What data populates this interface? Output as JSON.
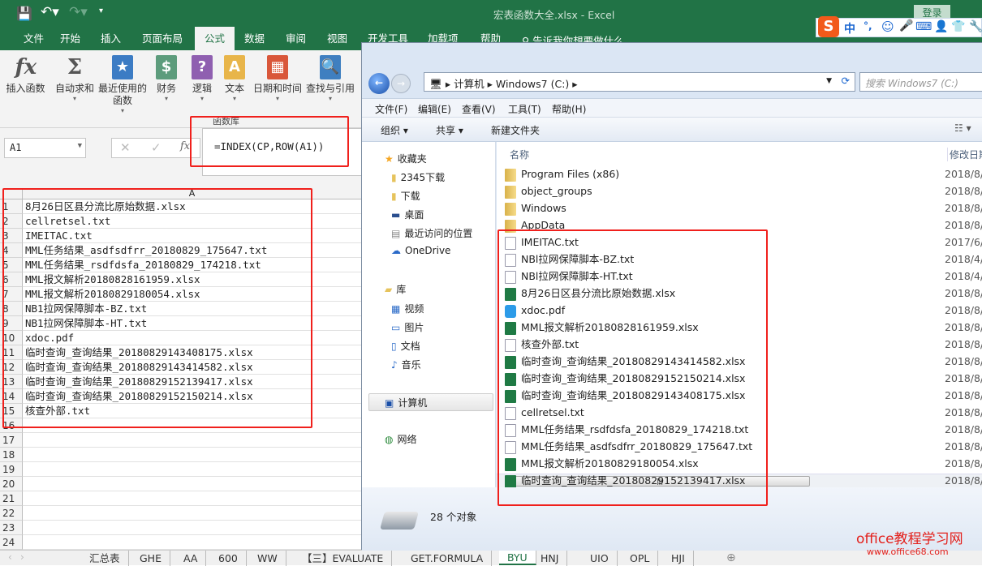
{
  "window_title": "宏表函数大全.xlsx  -  Excel",
  "login_label": "登录",
  "ribbon_tabs": [
    "文件",
    "开始",
    "插入",
    "页面布局",
    "公式",
    "数据",
    "审阅",
    "视图",
    "开发工具",
    "加载项",
    "帮助"
  ],
  "tell_me": "告诉我你想要做什么",
  "ime": {
    "lang": "中",
    "punct": "°,"
  },
  "ribbon_buttons": [
    {
      "label": "插入函数"
    },
    {
      "label": "自动求和"
    },
    {
      "label": "最近使用的函数"
    },
    {
      "label": "财务"
    },
    {
      "label": "逻辑"
    },
    {
      "label": "文本"
    },
    {
      "label": "日期和时间"
    },
    {
      "label": "查找与引用"
    }
  ],
  "group_label": "函数库",
  "name_box": "A1",
  "formula": "=INDEX(CP,ROW(A1))",
  "column_header": "A",
  "cells": [
    "8月26日区县分流比原始数据.xlsx",
    "cellretsel.txt",
    "IMEITAC.txt",
    "MML任务结果_asdfsdfrr_20180829_175647.txt",
    "MML任务结果_rsdfdsfa_20180829_174218.txt",
    "MML报文解析20180828161959.xlsx",
    "MML报文解析20180829180054.xlsx",
    "NB1拉网保障脚本-BZ.txt",
    "NB1拉网保障脚本-HT.txt",
    "xdoc.pdf",
    "临时查询_查询结果_20180829143408175.xlsx",
    "临时查询_查询结果_20180829143414582.xlsx",
    "临时查询_查询结果_20180829152139417.xlsx",
    "临时查询_查询结果_20180829152150214.xlsx",
    "核查外部.txt",
    "",
    "",
    "",
    "",
    "",
    "",
    "",
    "",
    ""
  ],
  "sheet_tabs": [
    "汇总表",
    "GHE",
    "AA",
    "600",
    "WW",
    "【三】EVALUATE",
    "GET.FORMULA",
    "BYU",
    "HNJ",
    "UIO",
    "OPL",
    "HJI"
  ],
  "active_sheet": "BYU",
  "explorer": {
    "breadcrumb": [
      "计算机",
      "Windows7 (C:)"
    ],
    "search_placeholder": "搜索 Windows7 (C:)",
    "menu": [
      "文件(F)",
      "编辑(E)",
      "查看(V)",
      "工具(T)",
      "帮助(H)"
    ],
    "toolbar": [
      "组织 ▾",
      "共享 ▾",
      "新建文件夹"
    ],
    "nav": {
      "favorites": "收藏夹",
      "favorite_items": [
        "2345下载",
        "下载",
        "桌面",
        "最近访问的位置",
        "OneDrive"
      ],
      "libraries": "库",
      "library_items": [
        "视频",
        "图片",
        "文档",
        "音乐"
      ],
      "computer": "计算机",
      "network": "网络"
    },
    "columns": [
      "名称",
      "修改日期"
    ],
    "files": [
      {
        "name": "Program Files (x86)",
        "type": "folder",
        "date": "2018/8/"
      },
      {
        "name": "object_groups",
        "type": "folder",
        "date": "2018/8/"
      },
      {
        "name": "Windows",
        "type": "folder",
        "date": "2018/8/"
      },
      {
        "name": "AppData",
        "type": "folder",
        "date": "2018/8/"
      },
      {
        "name": "IMEITAC.txt",
        "type": "txt",
        "date": "2017/6/"
      },
      {
        "name": "NBl拉网保障脚本-BZ.txt",
        "type": "txt",
        "date": "2018/4/"
      },
      {
        "name": "NBl拉网保障脚本-HT.txt",
        "type": "txt",
        "date": "2018/4/"
      },
      {
        "name": "8月26日区县分流比原始数据.xlsx",
        "type": "xlsx",
        "date": "2018/8/"
      },
      {
        "name": "xdoc.pdf",
        "type": "pdf",
        "date": "2018/8/"
      },
      {
        "name": "MML报文解析20180828161959.xlsx",
        "type": "xlsx",
        "date": "2018/8/"
      },
      {
        "name": "核查外部.txt",
        "type": "txt",
        "date": "2018/8/"
      },
      {
        "name": "临时查询_查询结果_20180829143414582.xlsx",
        "type": "xlsx",
        "date": "2018/8/"
      },
      {
        "name": "临时查询_查询结果_20180829152150214.xlsx",
        "type": "xlsx",
        "date": "2018/8/"
      },
      {
        "name": "临时查询_查询结果_20180829143408175.xlsx",
        "type": "xlsx",
        "date": "2018/8/"
      },
      {
        "name": "cellretsel.txt",
        "type": "txt",
        "date": "2018/8/"
      },
      {
        "name": "MML任务结果_rsdfdsfa_20180829_174218.txt",
        "type": "txt",
        "date": "2018/8/"
      },
      {
        "name": "MML任务结果_asdfsdfrr_20180829_175647.txt",
        "type": "txt",
        "date": "2018/8/"
      },
      {
        "name": "MML报文解析20180829180054.xlsx",
        "type": "xlsx",
        "date": "2018/8/"
      },
      {
        "name": "临时查询_查询结果_20180829152139417.xlsx",
        "type": "xlsx",
        "date": "2018/8/"
      }
    ],
    "status": "28 个对象"
  },
  "watermark": {
    "title": "office教程学习网",
    "url": "www.office68.com"
  },
  "colors": {
    "excel_green": "#217346",
    "highlight_red": "#f0201c"
  }
}
